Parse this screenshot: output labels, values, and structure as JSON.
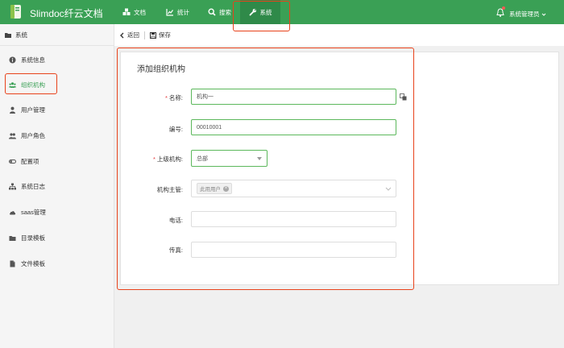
{
  "header": {
    "brand": "Slimdoc纤云文档",
    "nav": [
      {
        "label": "文档",
        "icon": "cubes-icon"
      },
      {
        "label": "统计",
        "icon": "chart-line-icon"
      },
      {
        "label": "搜索",
        "icon": "search-icon"
      },
      {
        "label": "系统",
        "icon": "wrench-icon"
      }
    ],
    "active_nav": "系统",
    "user": "系统管理员",
    "accent_color": "#3aa055"
  },
  "sidebar": {
    "title": "系统",
    "items": [
      {
        "label": "系统信息",
        "icon": "info-circle-icon"
      },
      {
        "label": "组织机构",
        "icon": "users-icon"
      },
      {
        "label": "用户管理",
        "icon": "user-icon"
      },
      {
        "label": "用户角色",
        "icon": "user-group-icon"
      },
      {
        "label": "配置项",
        "icon": "toggle-icon"
      },
      {
        "label": "系统日志",
        "icon": "sitemap-icon"
      },
      {
        "label": "saas管理",
        "icon": "cloud-icon"
      },
      {
        "label": "目录模板",
        "icon": "folder-icon"
      },
      {
        "label": "文件模板",
        "icon": "file-icon"
      }
    ],
    "active_item": "组织机构"
  },
  "toolbar": {
    "back": "返回",
    "save": "保存"
  },
  "form": {
    "title": "添加组织机构",
    "name": {
      "label": "名称:",
      "required": true,
      "value": "机构一"
    },
    "code": {
      "label": "编号:",
      "required": false,
      "value": "00010001"
    },
    "parent": {
      "label": "上级机构:",
      "required": true,
      "value": "总部"
    },
    "manager": {
      "label": "机构主管:",
      "required": false,
      "tag": "此用用户"
    },
    "phone": {
      "label": "电话:",
      "required": false,
      "value": ""
    },
    "fax": {
      "label": "传真:",
      "required": false,
      "value": ""
    }
  }
}
